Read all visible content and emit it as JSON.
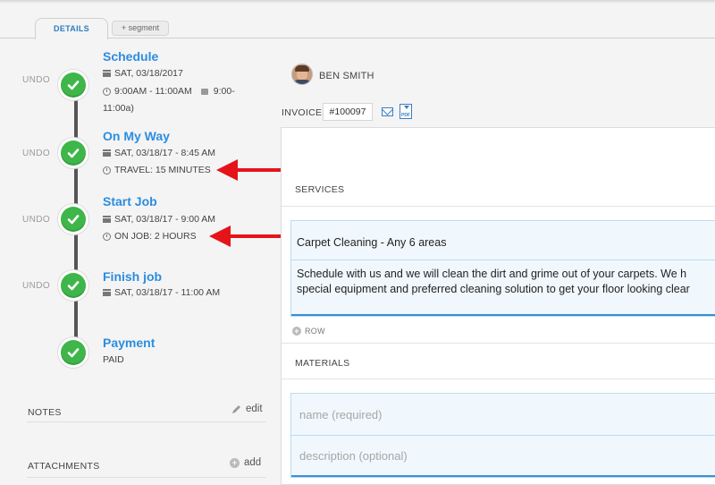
{
  "tabs": {
    "details": "DETAILS",
    "segment": "+ segment"
  },
  "timeline": {
    "undo_label": "UNDO",
    "steps": [
      {
        "title": "Schedule",
        "date": "SAT, 03/18/2017",
        "time": "9:00AM - 11:00AM",
        "extra": "9:00-",
        "extra2": "11:00a)"
      },
      {
        "title": "On My Way",
        "date": "SAT, 03/18/17 - 8:45 AM",
        "time": "TRAVEL: 15 MINUTES"
      },
      {
        "title": "Start Job",
        "date": "SAT, 03/18/17 - 9:00 AM",
        "time": "ON JOB: 2 HOURS"
      },
      {
        "title": "Finish job",
        "date": "SAT, 03/18/17 - 11:00 AM"
      },
      {
        "title": "Payment",
        "status": "PAID"
      }
    ]
  },
  "notes": {
    "label": "NOTES",
    "action": "edit"
  },
  "attachments": {
    "label": "ATTACHMENTS",
    "action": "add"
  },
  "customer": {
    "name": "BEN SMITH"
  },
  "invoice": {
    "label": "INVOICE",
    "number": "#100097",
    "pdf_label": "PDF"
  },
  "services": {
    "header": "SERVICES",
    "item_title": "Carpet Cleaning - Any 6 areas",
    "item_desc_1": "Schedule with us and we will clean the dirt and grime out of your carpets.  We h",
    "item_desc_2": "special equipment and preferred cleaning solution to get your floor looking clear",
    "add_row": "ROW"
  },
  "materials": {
    "header": "MATERIALS",
    "name_placeholder": "name (required)",
    "desc_placeholder": "description (optional)"
  },
  "colors": {
    "accent": "#2b8de0",
    "check": "#3eb64a",
    "arrow": "#e5141b"
  },
  "icons": [
    "calendar-icon",
    "clock-icon",
    "check-icon",
    "pencil-icon",
    "plus-circle-icon",
    "mail-icon",
    "pdf-download-icon"
  ]
}
